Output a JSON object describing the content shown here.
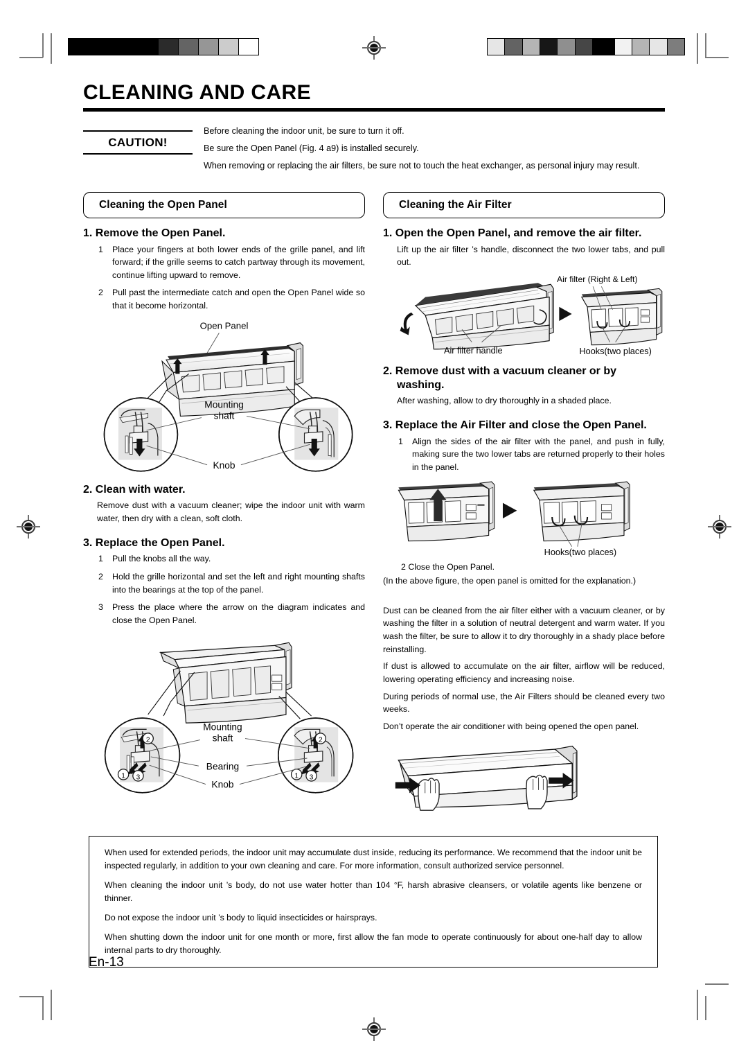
{
  "document": {
    "title": "CLEANING AND CARE",
    "page_number": "En-13"
  },
  "caution": {
    "label": "CAUTION!",
    "lines": [
      "Before cleaning the indoor unit, be sure to turn it off.",
      "Be sure the Open Panel (Fig. 4 a9) is installed securely.",
      "When removing or replacing the air filters, be sure not to touch the heat exchanger, as personal injury may result."
    ]
  },
  "left_column": {
    "section_title": "Cleaning the Open Panel",
    "step1": {
      "heading": "1. Remove the Open Panel.",
      "items": [
        {
          "num": "1",
          "text": "Place your fingers at both lower ends of the grille panel, and lift forward; if the grille seems to catch partway through its movement, continue lifting upward to remove."
        },
        {
          "num": "2",
          "text": "Pull past the intermediate catch and open the Open Panel wide so that it become horizontal."
        }
      ]
    },
    "figure1": {
      "labels": {
        "open_panel": "Open Panel",
        "mounting_shaft": "Mounting\nshaft",
        "mounting_shaft_line1": "Mounting",
        "mounting_shaft_line2": "shaft",
        "knob": "Knob"
      }
    },
    "step2": {
      "heading": "2. Clean with water.",
      "body": "Remove dust with a vacuum cleaner; wipe the indoor unit with warm water, then dry with a clean, soft cloth."
    },
    "step3": {
      "heading": "3. Replace the Open Panel.",
      "items": [
        {
          "num": "1",
          "text": "Pull the knobs all the way."
        },
        {
          "num": "2",
          "text": "Hold the grille horizontal and set the left and right mounting shafts into the bearings at the top of the panel."
        },
        {
          "num": "3",
          "text": "Press the place where the arrow on the diagram indicates and close the Open Panel."
        }
      ]
    },
    "figure2": {
      "labels": {
        "mounting_shaft_line1": "Mounting",
        "mounting_shaft_line2": "shaft",
        "bearing": "Bearing",
        "knob": "Knob",
        "callout_1": "1",
        "callout_2": "2",
        "callout_3": "3"
      }
    }
  },
  "right_column": {
    "section_title": "Cleaning the Air Filter",
    "step1": {
      "heading": "1. Open the Open Panel, and remove the air filter.",
      "body": "Lift up the air filter  ’s handle, disconnect the two lower tabs, and pull out."
    },
    "figure1": {
      "labels": {
        "air_filter_right_left": "Air filter (Right & Left)",
        "air_filter_handle": "Air filter handle",
        "hooks": "Hooks(two places)"
      }
    },
    "step2": {
      "heading": "2. Remove dust with a vacuum cleaner or by washing.",
      "body": "After washing, allow to dry thoroughly in a shaded place."
    },
    "step3": {
      "heading": "3. Replace the Air Filter and close the Open Panel.",
      "items": [
        {
          "num": "1",
          "text": "Align the sides of the air filter with the panel, and push in fully, making sure the two lower tabs are returned properly to their holes in the panel."
        }
      ],
      "item2_inline": "2   Close the Open Panel.",
      "explanation": "(In the above figure, the open panel is omitted for the explanation.)"
    },
    "figure2": {
      "labels": {
        "hooks": "Hooks(two places)"
      }
    },
    "notes": [
      "Dust can be cleaned from the air filter either with a vacuum cleaner, or by washing the filter in a solution of neutral detergent and warm water. If you wash the filter, be sure to allow it to dry thoroughly in a shady place before reinstalling.",
      "If dust is allowed to accumulate on the air filter, airflow will be reduced, lowering operating efficiency and increasing noise.",
      "During periods of normal use, the Air Filters should be cleaned every two weeks.",
      "Don’t operate the air conditioner with being opened the open panel."
    ]
  },
  "notice_box": {
    "paragraphs": [
      "When used for extended periods, the indoor unit may accumulate dust inside, reducing its performance. We recommend that the indoor unit be inspected regularly, in addition to your own cleaning and care. For more information, consult authorized service personnel.",
      "When cleaning the indoor unit    ’s body, do not use water hotter than 104    °F, harsh abrasive cleansers, or volatile agents like benzene or thinner.",
      "Do not expose the indoor unit    ’s body to liquid insecticides or hairsprays.",
      "When shutting down the indoor unit for one month or more, first allow the fan mode to operate continuously for about one-half day to allow internal parts to dry thoroughly."
    ]
  },
  "print_marks": {
    "calibration_bar_left": [
      "#000000",
      "#000000",
      "#2b2b2b",
      "#646464",
      "#969696",
      "#cccccc",
      "#ffffff"
    ],
    "calibration_bar_right": [
      "#e6e6e6",
      "#636363",
      "#b5b5b5",
      "#171717",
      "#8f8f8f",
      "#464646",
      "#000000",
      "#f2f2f2",
      "#b5b5b5",
      "#e6e6e6",
      "#7d7d7d"
    ]
  }
}
